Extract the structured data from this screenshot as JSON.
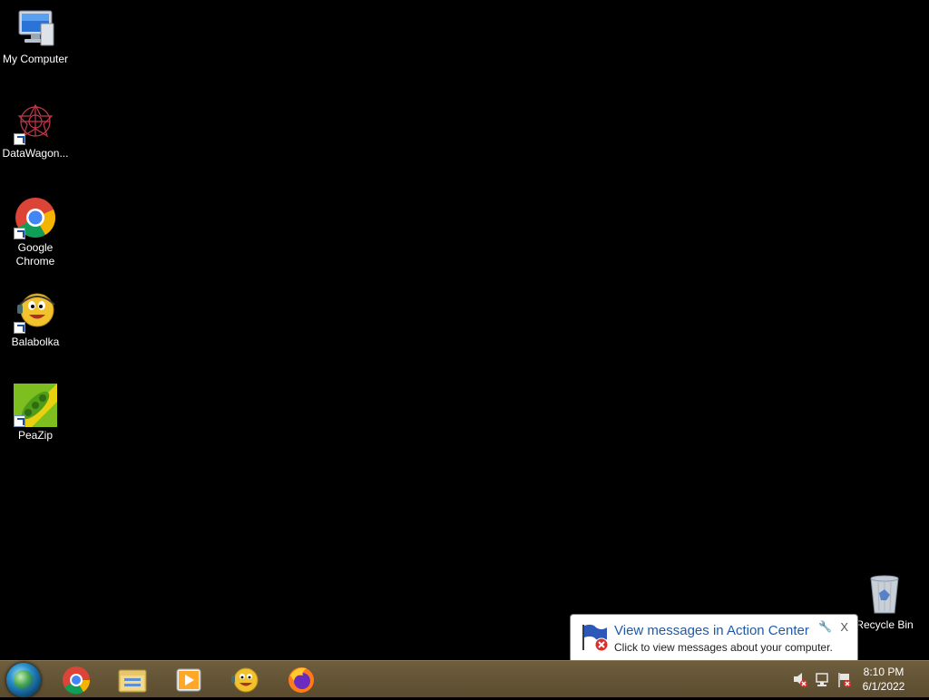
{
  "desktop": {
    "icons": [
      {
        "label": "My Computer",
        "icon": "computer-icon"
      },
      {
        "label": "DataWagon...",
        "icon": "datawagon-icon"
      },
      {
        "label": "Google Chrome",
        "icon": "chrome-icon"
      },
      {
        "label": "Balabolka",
        "icon": "balabolka-icon"
      },
      {
        "label": "PeaZip",
        "icon": "peazip-icon"
      },
      {
        "label": "Recycle Bin",
        "icon": "recycle-bin-icon"
      }
    ]
  },
  "notification": {
    "title": "View messages in Action Center",
    "message": "Click to view messages about your computer.",
    "close_label": "X"
  },
  "taskbar": {
    "pinned": [
      "chrome-icon",
      "file-explorer-icon",
      "media-player-icon",
      "balabolka-icon",
      "firefox-icon"
    ],
    "tray": [
      "volume-muted-icon",
      "network-icon",
      "action-center-flag-icon"
    ],
    "clock": {
      "time": "8:10 PM",
      "date": "6/1/2022"
    }
  }
}
